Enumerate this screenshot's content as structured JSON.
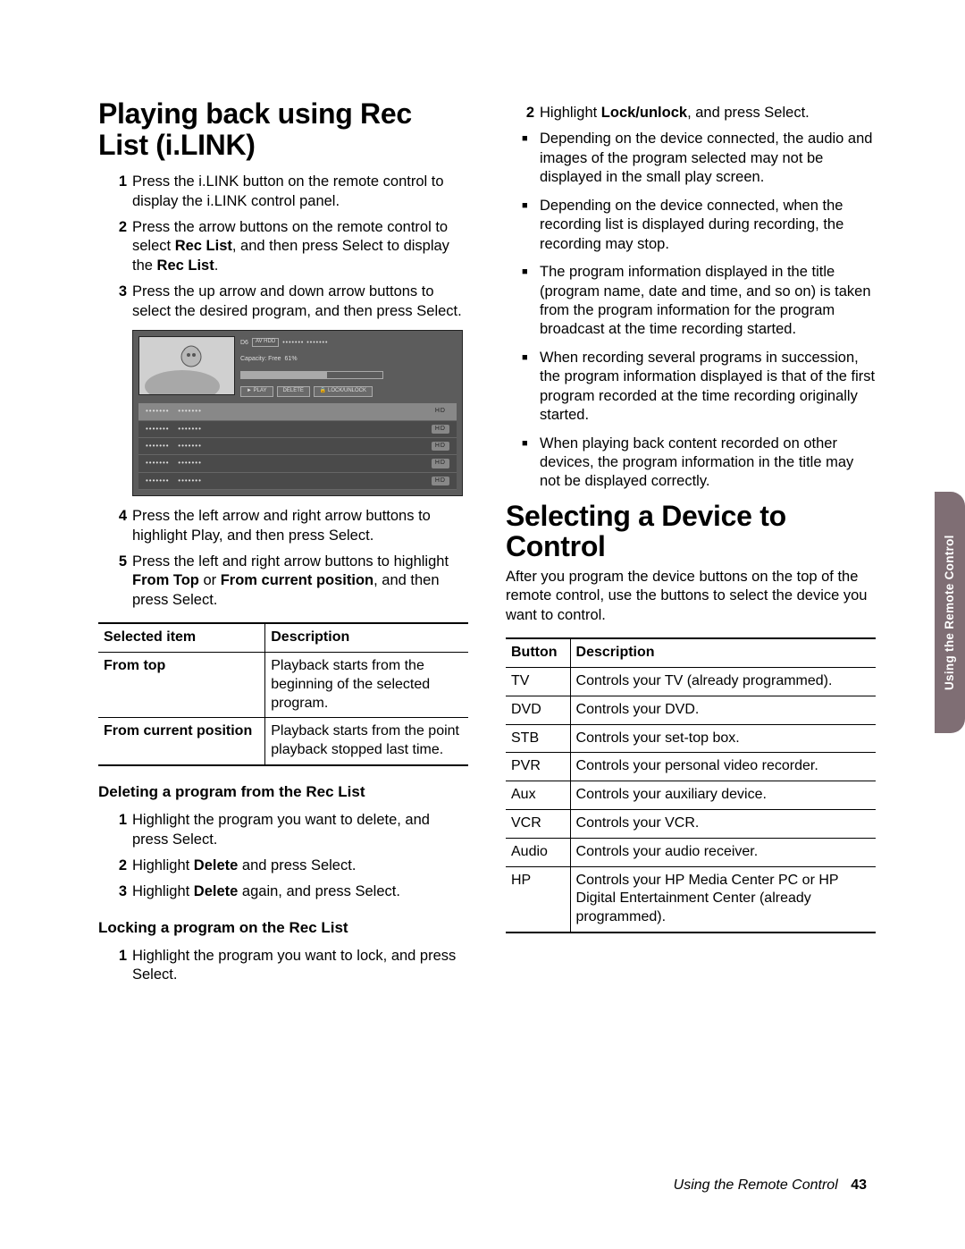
{
  "col1": {
    "h1": "Playing back using Rec List (i.LINK)",
    "steps_a": [
      {
        "n": "1",
        "t": "Press the i.LINK button on the remote control to display the i.LINK control panel."
      },
      {
        "n": "2",
        "pre": "Press the arrow buttons on the remote control to select ",
        "b1": "Rec List",
        "mid": ", and then press Select to display the ",
        "b2": "Rec List",
        "post": "."
      },
      {
        "n": "3",
        "t": "Press the up arrow and down arrow buttons to select the desired program, and then press Select."
      }
    ],
    "ilink": {
      "line1_prefix": "D6",
      "line1_chip": "AV HDD",
      "capacity_label": "Capacity: Free",
      "capacity_pct": "61%",
      "btn_play": "► PLAY",
      "btn_delete": "DELETE",
      "btn_lock": "🔒 LOCK/UNLOCK",
      "rows": [
        {
          "a": "•••••••",
          "b": "•••••••",
          "hd": "HD"
        },
        {
          "a": "•••••••",
          "b": "•••••••",
          "hd": "HD"
        },
        {
          "a": "•••••••",
          "b": "•••••••",
          "hd": "HD"
        },
        {
          "a": "•••••••",
          "b": "•••••••",
          "hd": "HD"
        },
        {
          "a": "•••••••",
          "b": "•••••••",
          "hd": "HD"
        }
      ]
    },
    "steps_b": [
      {
        "n": "4",
        "t": "Press the left arrow and right arrow buttons to highlight Play, and then press Select."
      },
      {
        "n": "5",
        "pre": "Press the left and right arrow buttons to highlight ",
        "b1": "From Top",
        "mid": " or ",
        "b2": "From current position",
        "post": ", and then press Select."
      }
    ],
    "table1": {
      "h1": "Selected item",
      "h2": "Description",
      "rows": [
        {
          "a": "From top",
          "b": "Playback starts from the beginning of the selected program."
        },
        {
          "a": "From current position",
          "b": "Playback starts from the point playback stopped last time."
        }
      ]
    },
    "h3a": "Deleting a program from the Rec List",
    "del_steps": [
      {
        "n": "1",
        "t": "Highlight the program you want to delete, and press Select."
      },
      {
        "n": "2",
        "pre": "Highlight ",
        "b1": "Delete",
        "post": " and press Select."
      },
      {
        "n": "3",
        "pre": "Highlight ",
        "b1": "Delete",
        "post": " again, and press Select."
      }
    ],
    "h3b": "Locking a program on the Rec List",
    "lock_steps": [
      {
        "n": "1",
        "t": "Highlight the program you want to lock, and press Select."
      }
    ]
  },
  "col2": {
    "step2": {
      "n": "2",
      "pre": "Highlight ",
      "b1": "Lock/unlock",
      "post": ", and press Select."
    },
    "bullets": [
      "Depending on the device connected, the audio and images of the program selected may not be displayed in the small play screen.",
      "Depending on the device connected, when the recording list is displayed during recording, the recording may stop.",
      "The program information displayed in the title (program name, date and time, and so on) is taken from the program information for the program broadcast at the time recording started.",
      "When recording several programs in succession, the program information displayed is that of the first program recorded at the time recording originally started.",
      "When playing back content recorded on other devices, the program information in the title may not be displayed correctly."
    ],
    "h2": "Selecting a Device to Control",
    "intro": "After you program the device buttons on the top of the remote control, use the buttons to select the device you want to control.",
    "table2": {
      "h1": "Button",
      "h2": "Description",
      "rows": [
        {
          "a": "TV",
          "b": "Controls your TV (already programmed)."
        },
        {
          "a": "DVD",
          "b": "Controls your DVD."
        },
        {
          "a": "STB",
          "b": "Controls your set-top box."
        },
        {
          "a": "PVR",
          "b": "Controls your personal video recorder."
        },
        {
          "a": "Aux",
          "b": "Controls your auxiliary device."
        },
        {
          "a": "VCR",
          "b": "Controls your VCR."
        },
        {
          "a": "Audio",
          "b": "Controls your audio receiver."
        },
        {
          "a": "HP",
          "b": "Controls your HP Media Center PC or HP Digital Entertainment Center (already programmed)."
        }
      ]
    }
  },
  "tab": "Using the Remote Control",
  "footer_section": "Using the Remote Control",
  "footer_page": "43"
}
